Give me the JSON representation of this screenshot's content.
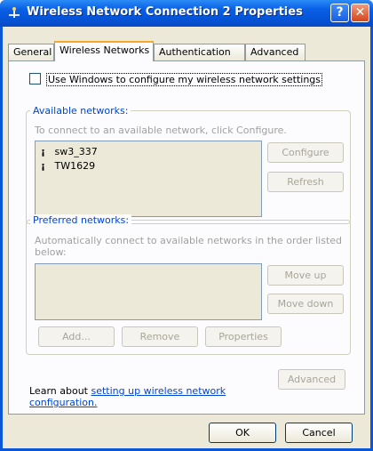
{
  "window": {
    "title": "Wireless Network Connection 2 Properties",
    "help_button": "?",
    "close_button": "✕"
  },
  "tabs": [
    {
      "label": "General"
    },
    {
      "label": "Wireless Networks"
    },
    {
      "label": "Authentication"
    },
    {
      "label": "Advanced"
    }
  ],
  "checkbox": {
    "label": "Use Windows to configure my wireless network settings",
    "checked": false
  },
  "available_networks": {
    "legend": "Available networks:",
    "instruction": "To connect to an available network, click Configure.",
    "networks": [
      {
        "name": "sw3_337",
        "icon": "antenna-icon"
      },
      {
        "name": "TW1629",
        "icon": "antenna-icon"
      }
    ],
    "configure_button": "Configure",
    "refresh_button": "Refresh"
  },
  "preferred_networks": {
    "legend": "Preferred networks:",
    "instruction": "Automatically connect to available networks in the order listed below:",
    "move_up_button": "Move up",
    "move_down_button": "Move down",
    "add_button": "Add...",
    "remove_button": "Remove",
    "properties_button": "Properties"
  },
  "learn": {
    "prefix": "Learn about ",
    "link": "setting up wireless network configuration.",
    "advanced_button": "Advanced"
  },
  "footer": {
    "ok_button": "OK",
    "cancel_button": "Cancel"
  },
  "colors": {
    "title_bar": "#0a5fe5",
    "dialog_bg": "#ece9d8",
    "link": "#0046d5",
    "tab_highlight": "#f7a92a"
  }
}
